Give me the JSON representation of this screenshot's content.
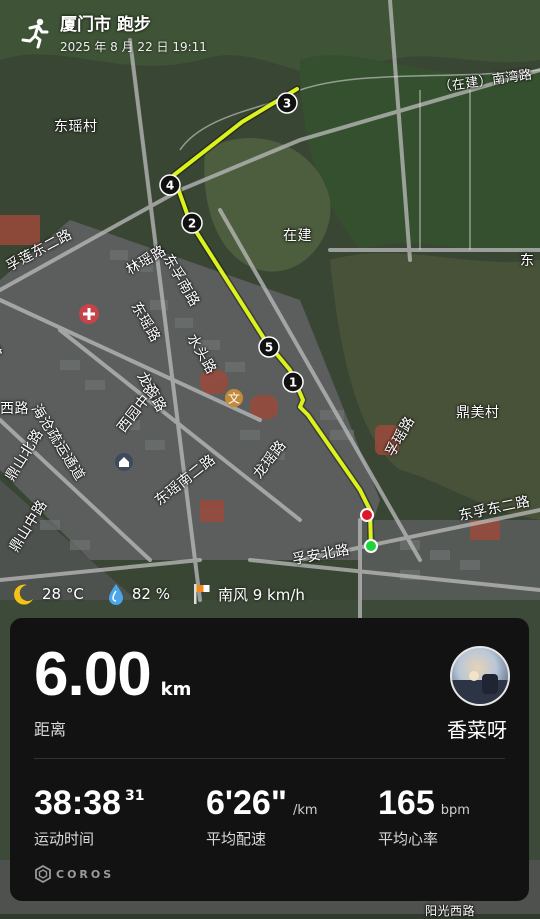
{
  "header": {
    "title": "厦门市 跑步",
    "date": "2025 年 8 月 22 日 19:11"
  },
  "map": {
    "labels": {
      "dongyao_village": "东瑶村",
      "nanwan_road": "（在建）南湾路",
      "zaijian": "在建",
      "dongfu_east2": "孚莲东二路",
      "linyi_road": "林瑶路",
      "dongfu_south": "东孚南路",
      "dongyao_road": "东瑶路",
      "shuitou_road": "水头路",
      "longxing_road": "龙西路",
      "xiyuan_road": "西园中路",
      "dongyao_south2": "东瑶南二路",
      "longyao_road": "龙瑶路",
      "haicang_road": "海沧疏运通道",
      "dingshan_north": "鼎山北路",
      "dingshan_mid": "鼎山中路",
      "dingmei_village": "鼎美村",
      "dongfu_east2_right": "东孚东二路",
      "furong_road": "孚瑶路",
      "fuan_north": "孚安北路",
      "xi_road": "西路",
      "lu_road": "路",
      "dong_right": "东",
      "bottom_road": "阳光西路"
    },
    "markers": [
      "1",
      "2",
      "3",
      "4",
      "5"
    ]
  },
  "weather": {
    "temperature": "28 °C",
    "humidity": "82 %",
    "wind": "南风 9 km/h"
  },
  "summary": {
    "distance_value": "6.00",
    "distance_unit": "km",
    "distance_label": "距离",
    "user_name": "香菜呀",
    "duration_value": "38:38",
    "duration_sup": "31",
    "duration_label": "运动时间",
    "pace_value": "6'26\"",
    "pace_unit": "/km",
    "pace_label": "平均配速",
    "hr_value": "165",
    "hr_unit": "bpm",
    "hr_label": "平均心率",
    "brand": "COROS"
  }
}
